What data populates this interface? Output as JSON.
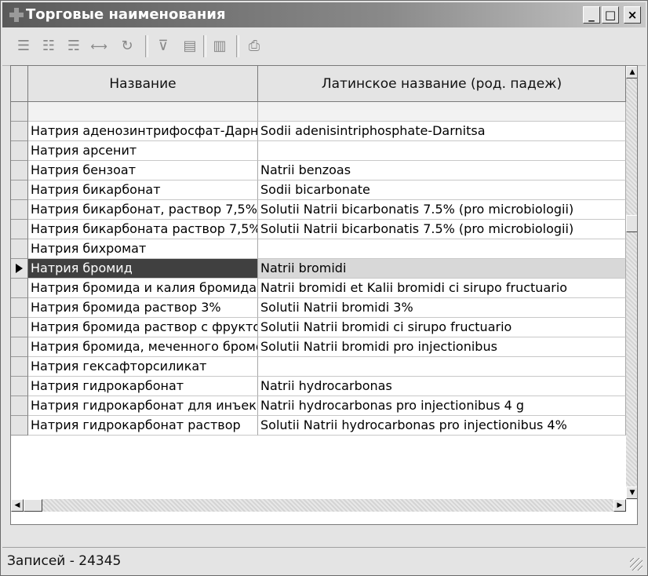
{
  "window": {
    "title": "Торговые наименования",
    "icon": "plus-cross-icon",
    "buttons": {
      "minimize": "_",
      "maximize": "□",
      "close": "×"
    }
  },
  "toolbar": {
    "icons": [
      "insert-row-icon",
      "delete-row-icon",
      "edit-row-icon",
      "fit-columns-icon",
      "refresh-icon",
      "clear-filter-icon",
      "filter-table-icon",
      "filter-selected-icon",
      "print-icon"
    ]
  },
  "table": {
    "columns": [
      "Название",
      "Латинское название (род. падеж)"
    ],
    "filter_row": [
      "",
      ""
    ],
    "rows": [
      [
        "Натрия аденозинтрифосфат-Дарница",
        "Sodii adenisintriphosphate-Darnitsa"
      ],
      [
        "Натрия арсенит",
        ""
      ],
      [
        "Натрия бензоат",
        "Natrii benzoas"
      ],
      [
        "Натрия бикарбонат",
        "Sodii bicarbonate"
      ],
      [
        "Натрия бикарбонат, раствор 7,5%",
        "Solutii Natrii bicarbonatis 7.5% (pro microbiologii)"
      ],
      [
        "Натрия бикарбоната раствор 7,5%",
        "Solutii Natrii bicarbonatis 7.5% (pro microbiologii)"
      ],
      [
        "Натрия бихромат",
        ""
      ],
      [
        "Натрия бромид",
        "Natrii bromidi"
      ],
      [
        "Натрия бромида и калия бромида",
        "Natrii bromidi et Kalii bromidi ci sirupo fructuario"
      ],
      [
        "Натрия бромида раствор 3%",
        "Solutii Natrii bromidi 3%"
      ],
      [
        "Натрия бромида раствор с фруктозой",
        "Solutii Natrii bromidi ci sirupo fructuario"
      ],
      [
        "Натрия бромида, меченного бромом",
        "Solutii Natrii bromidi pro injectionibus"
      ],
      [
        "Натрия гексафторсиликат",
        ""
      ],
      [
        "Натрия гидрокарбонат",
        "Natrii hydrocarbonas"
      ],
      [
        "Натрия гидрокарбонат для инъекций",
        "Natrii hydrocarbonas pro injectionibus 4 g"
      ],
      [
        "Натрия гидрокарбонат раствор",
        "Solutii Natrii hydrocarbonas pro injectionibus 4%"
      ]
    ],
    "selected_row": 7
  },
  "status": {
    "records": "Записей - 24345"
  }
}
